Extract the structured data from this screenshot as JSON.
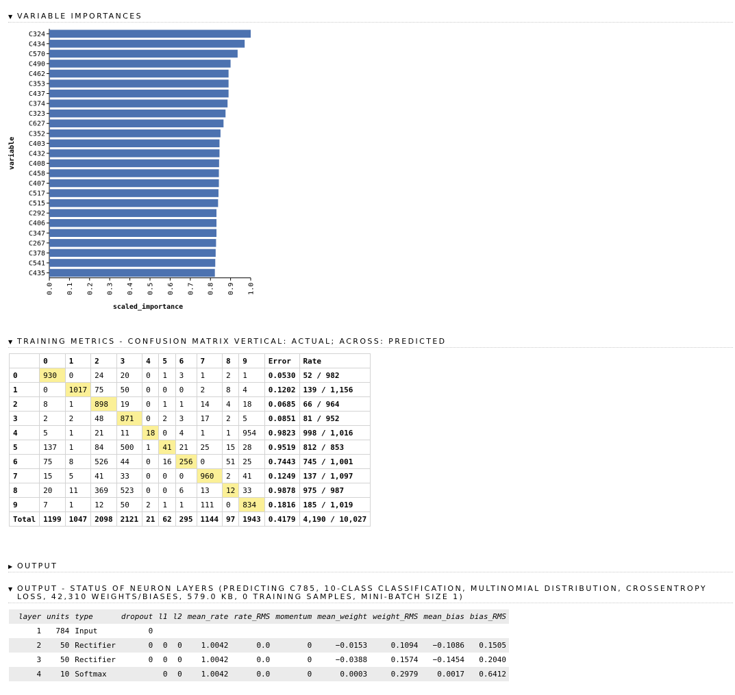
{
  "sections": {
    "var_imp": "VARIABLE IMPORTANCES",
    "training_metrics": "TRAINING METRICS - CONFUSION MATRIX VERTICAL: ACTUAL; ACROSS: PREDICTED",
    "output": "OUTPUT",
    "neuron_layers": "OUTPUT - STATUS OF NEURON LAYERS (PREDICTING C785, 10-CLASS CLASSIFICATION, MULTINOMIAL DISTRIBUTION, CROSSENTROPY LOSS, 42,310 WEIGHTS/BIASES, 579.0 KB, 0 TRAINING SAMPLES, MINI-BATCH SIZE 1)"
  },
  "chart_data": {
    "type": "bar",
    "orientation": "horizontal",
    "xlabel": "scaled_importance",
    "ylabel": "variable",
    "xlim": [
      0,
      1
    ],
    "xticks": [
      "0.0",
      "0.1",
      "0.2",
      "0.3",
      "0.4",
      "0.5",
      "0.6",
      "0.7",
      "0.8",
      "0.9",
      "1.0"
    ],
    "bar_color": "#4c72b0",
    "categories": [
      "C324",
      "C434",
      "C570",
      "C490",
      "C462",
      "C353",
      "C437",
      "C374",
      "C323",
      "C627",
      "C352",
      "C403",
      "C432",
      "C408",
      "C458",
      "C407",
      "C517",
      "C515",
      "C292",
      "C406",
      "C347",
      "C267",
      "C378",
      "C541",
      "C435"
    ],
    "values": [
      1.0,
      0.97,
      0.935,
      0.9,
      0.89,
      0.89,
      0.89,
      0.885,
      0.875,
      0.865,
      0.85,
      0.845,
      0.845,
      0.843,
      0.842,
      0.842,
      0.84,
      0.838,
      0.83,
      0.83,
      0.83,
      0.828,
      0.826,
      0.824,
      0.822
    ]
  },
  "confusion": {
    "headers": [
      "",
      "0",
      "1",
      "2",
      "3",
      "4",
      "5",
      "6",
      "7",
      "8",
      "9",
      "Error",
      "Rate"
    ],
    "rows": [
      {
        "label": "0",
        "cells": [
          "930",
          "0",
          "24",
          "20",
          "0",
          "1",
          "3",
          "1",
          "2",
          "1"
        ],
        "error": "0.0530",
        "rate": "52 / 982"
      },
      {
        "label": "1",
        "cells": [
          "0",
          "1017",
          "75",
          "50",
          "0",
          "0",
          "0",
          "2",
          "8",
          "4"
        ],
        "error": "0.1202",
        "rate": "139 / 1,156"
      },
      {
        "label": "2",
        "cells": [
          "8",
          "1",
          "898",
          "19",
          "0",
          "1",
          "1",
          "14",
          "4",
          "18"
        ],
        "error": "0.0685",
        "rate": "66 / 964"
      },
      {
        "label": "3",
        "cells": [
          "2",
          "2",
          "48",
          "871",
          "0",
          "2",
          "3",
          "17",
          "2",
          "5"
        ],
        "error": "0.0851",
        "rate": "81 / 952"
      },
      {
        "label": "4",
        "cells": [
          "5",
          "1",
          "21",
          "11",
          "18",
          "0",
          "4",
          "1",
          "1",
          "954"
        ],
        "error": "0.9823",
        "rate": "998 / 1,016"
      },
      {
        "label": "5",
        "cells": [
          "137",
          "1",
          "84",
          "500",
          "1",
          "41",
          "21",
          "25",
          "15",
          "28"
        ],
        "error": "0.9519",
        "rate": "812 / 853"
      },
      {
        "label": "6",
        "cells": [
          "75",
          "8",
          "526",
          "44",
          "0",
          "16",
          "256",
          "0",
          "51",
          "25"
        ],
        "error": "0.7443",
        "rate": "745 / 1,001"
      },
      {
        "label": "7",
        "cells": [
          "15",
          "5",
          "41",
          "33",
          "0",
          "0",
          "0",
          "960",
          "2",
          "41"
        ],
        "error": "0.1249",
        "rate": "137 / 1,097"
      },
      {
        "label": "8",
        "cells": [
          "20",
          "11",
          "369",
          "523",
          "0",
          "0",
          "6",
          "13",
          "12",
          "33"
        ],
        "error": "0.9878",
        "rate": "975 / 987"
      },
      {
        "label": "9",
        "cells": [
          "7",
          "1",
          "12",
          "50",
          "2",
          "1",
          "1",
          "111",
          "0",
          "834"
        ],
        "error": "0.1816",
        "rate": "185 / 1,019"
      }
    ],
    "total": {
      "label": "Total",
      "cells": [
        "1199",
        "1047",
        "2098",
        "2121",
        "21",
        "62",
        "295",
        "1144",
        "97",
        "1943"
      ],
      "error": "0.4179",
      "rate": "4,190 / 10,027"
    },
    "highlight_color": "#fbf097"
  },
  "layers": {
    "headers": [
      "layer",
      "units",
      "type",
      "dropout",
      "l1",
      "l2",
      "mean_rate",
      "rate_RMS",
      "momentum",
      "mean_weight",
      "weight_RMS",
      "mean_bias",
      "bias_RMS"
    ],
    "rows": [
      [
        "1",
        "784",
        "Input",
        "0",
        "",
        "",
        "",
        "",
        "",
        "",
        "",
        "",
        ""
      ],
      [
        "2",
        "50",
        "Rectifier",
        "0",
        "0",
        "0",
        "1.0042",
        "0.0",
        "0",
        "−0.0153",
        "0.1094",
        "−0.1086",
        "0.1505"
      ],
      [
        "3",
        "50",
        "Rectifier",
        "0",
        "0",
        "0",
        "1.0042",
        "0.0",
        "0",
        "−0.0388",
        "0.1574",
        "−0.1454",
        "0.2040"
      ],
      [
        "4",
        "10",
        "Softmax",
        "",
        "0",
        "0",
        "1.0042",
        "0.0",
        "0",
        "0.0003",
        "0.2979",
        "0.0017",
        "0.6412"
      ]
    ]
  }
}
